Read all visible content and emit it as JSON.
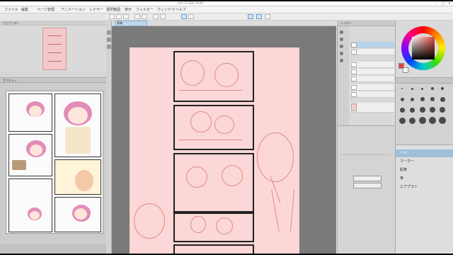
{
  "window": {
    "title": "CLIP STUDIO PAINT",
    "controls": [
      "–",
      "□",
      "×"
    ]
  },
  "menubar": {
    "items": [
      "ファイル",
      "編集",
      "ページ管理",
      "アニメーション",
      "レイヤー",
      "選択範囲",
      "表示",
      "フィルター",
      "ウィンドウ",
      "ヘルプ"
    ]
  },
  "navigator": {
    "title": "ナビゲーター"
  },
  "sub_view": {
    "title": "サブビュー"
  },
  "canvas": {
    "tab_label": "原稿"
  },
  "layers": {
    "title": "レイヤー",
    "rows": [
      "",
      "",
      "",
      "",
      "",
      "",
      "",
      ""
    ]
  },
  "tools": {
    "items": [
      "ペン",
      "マーカー",
      "鉛筆",
      "筆",
      "エアブラシ"
    ],
    "selected_index": 0
  },
  "properties": {
    "button_left": "",
    "button_right": ""
  },
  "colors": {
    "main": "#e0483a",
    "sub": "#ffffff",
    "accent": "#9fbfd9"
  }
}
